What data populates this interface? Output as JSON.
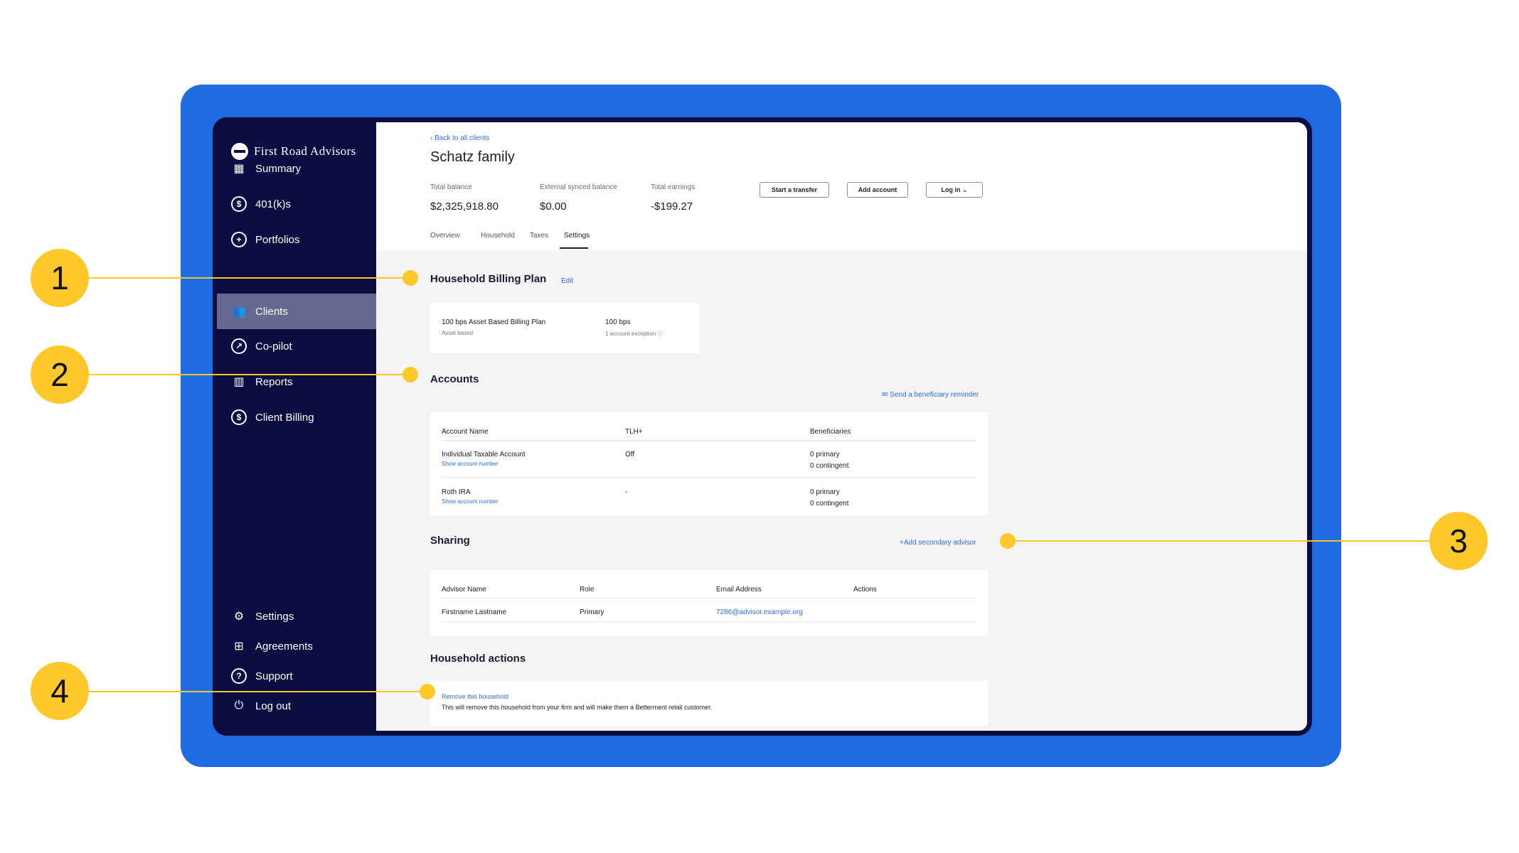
{
  "colors": {
    "frame": "#1f6be2",
    "sidebar": "#0b0c41",
    "active_nav": "#656991",
    "link": "#2e6de6",
    "callout": "#ffc82a"
  },
  "brand": {
    "name": "First Road Advisors"
  },
  "sidebar": {
    "items": [
      {
        "label": "Summary",
        "icon": "building-icon"
      },
      {
        "label": "401(k)s",
        "icon": "dollar-circle-icon"
      },
      {
        "label": "Portfolios",
        "icon": "pie-chart-icon"
      },
      {
        "label": "Clients",
        "icon": "people-icon"
      },
      {
        "label": "Co-pilot",
        "icon": "compass-icon"
      },
      {
        "label": "Reports",
        "icon": "report-icon"
      },
      {
        "label": "Client Billing",
        "icon": "dollar-circle-icon"
      }
    ],
    "bottom_items": [
      {
        "label": "Settings",
        "icon": "gear-icon"
      },
      {
        "label": "Agreements",
        "icon": "document-plus-icon"
      },
      {
        "label": "Support",
        "icon": "question-icon"
      },
      {
        "label": "Log out",
        "icon": "power-icon"
      }
    ]
  },
  "header": {
    "back_link": "Back to all clients",
    "title": "Schatz family",
    "stats": [
      {
        "label": "Total balance",
        "value": "$2,325,918.80"
      },
      {
        "label": "External synced balance",
        "value": "$0.00"
      },
      {
        "label": "Total earnings",
        "value": "-$199.27"
      }
    ],
    "buttons": {
      "transfer": "Start a transfer",
      "add_account": "Add account",
      "login": "Log in"
    },
    "tabs": [
      "Overview",
      "Household",
      "Taxes",
      "Settings"
    ],
    "active_tab": "Settings"
  },
  "billing": {
    "title": "Household Billing Plan",
    "edit": "Edit",
    "plan_name": "100 bps Asset Based Billing Plan",
    "plan_type": "Asset based",
    "rate": "100 bps",
    "exception": "1 account exception"
  },
  "accounts": {
    "title": "Accounts",
    "reminder": "Send a beneficiary reminder",
    "columns": [
      "Account Name",
      "TLH+",
      "Beneficiaries"
    ],
    "rows": [
      {
        "name": "Individual Taxable Account",
        "link": "Show account number",
        "tlh": "Off",
        "primary": "0 primary",
        "contingent": "0 contingent"
      },
      {
        "name": "Roth IRA",
        "link": "Show account number",
        "tlh": "-",
        "primary": "0 primary",
        "contingent": "0 contingent"
      }
    ]
  },
  "sharing": {
    "title": "Sharing",
    "add": "Add secondary advisor",
    "columns": [
      "Advisor Name",
      "Role",
      "Email Address",
      "Actions"
    ],
    "rows": [
      {
        "name": "Firstname Lastname",
        "role": "Primary",
        "email": "7286@advisor.example.org"
      }
    ]
  },
  "household_actions": {
    "title": "Household actions",
    "remove": "Remove this household",
    "description": "This will remove this household from your firm and will make them a Betterment retail customer."
  },
  "callouts": [
    "1",
    "2",
    "3",
    "4"
  ]
}
